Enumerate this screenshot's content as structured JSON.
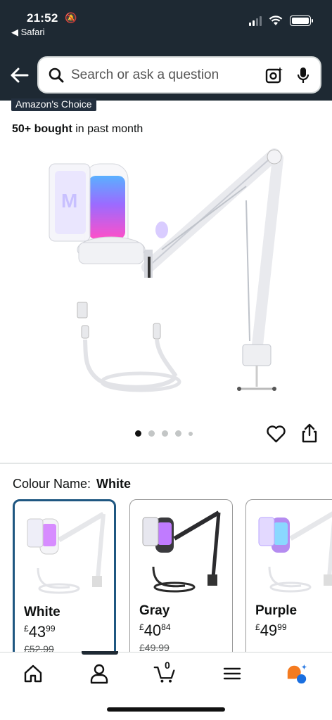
{
  "status_bar": {
    "time": "21:52",
    "back_app": "◀ Safari"
  },
  "search": {
    "placeholder": "Search or ask a question"
  },
  "product": {
    "badge": "Amazon's Choice",
    "bought_bold": "50+ bought",
    "bought_rest": "in past month",
    "image_count": 5,
    "active_image": 1
  },
  "colour": {
    "label": "Colour Name:",
    "value": "White",
    "options": [
      {
        "name": "White",
        "price_main": "43",
        "price_frac": "99",
        "currency": "£",
        "old_price": "£52.99",
        "selected": true
      },
      {
        "name": "Gray",
        "price_main": "40",
        "price_frac": "84",
        "currency": "£",
        "old_price": "£49.99",
        "selected": false
      },
      {
        "name": "Purple",
        "price_main": "49",
        "price_frac": "99",
        "currency": "£",
        "old_price": "",
        "selected": false
      }
    ]
  },
  "tabbar": {
    "cart_count": "0",
    "items": [
      "home-icon",
      "account-icon",
      "cart-icon",
      "menu-icon",
      "rufus-icon"
    ]
  },
  "colors": {
    "header_bg": "#1e2933",
    "selected_border": "#1f5781",
    "rufus_orange": "#f47b20",
    "rufus_blue": "#1a6fe0"
  }
}
